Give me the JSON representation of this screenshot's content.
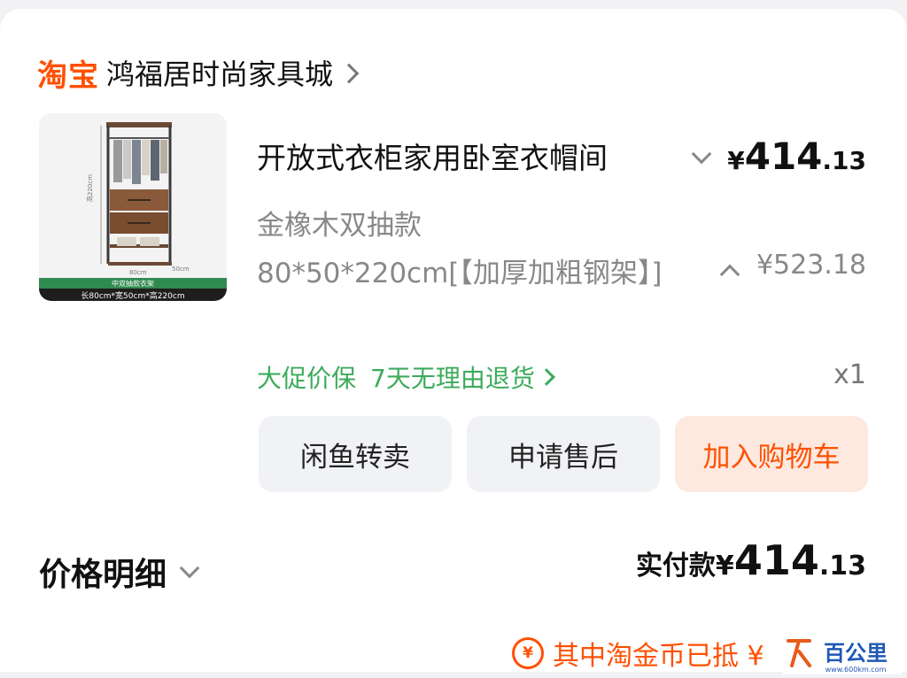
{
  "shop": {
    "logo": "淘宝",
    "name": "鸿福居时尚家具城"
  },
  "product": {
    "title": "开放式衣柜家用卧室衣帽间",
    "price_symbol": "¥",
    "price_int": "414",
    "price_dec": ".13",
    "spec": "金橡木双抽款 80*50*220cm[【加厚加粗钢架】]",
    "original_price": "¥523.18",
    "quantity": "x1",
    "services": [
      "大促价保",
      "7天无理由退货"
    ],
    "thumb_caption_top": "中双抽款衣架",
    "thumb_caption_bottom": "长80cm*宽50cm*高220cm",
    "thumb_dim_height": "高220cm",
    "thumb_dim_width": "80cm",
    "thumb_dim_depth": "50cm"
  },
  "actions": {
    "resell": "闲鱼转卖",
    "after_sales": "申请售后",
    "add_to_cart": "加入购物车"
  },
  "summary": {
    "detail_label": "价格明细",
    "paid_label": "实付款¥",
    "paid_int": "414",
    "paid_dec": ".13",
    "coin_icon": "¥",
    "coin_text": "其中淘金币已抵 ¥"
  },
  "watermark": {
    "text": "百公里",
    "url_text": "www.600km.com"
  },
  "colors": {
    "brand": "#ff5000",
    "service_green": "#3cab5b",
    "gray_text": "#888888",
    "button_bg": "#f1f2f5",
    "cart_button_bg": "#fde9df"
  }
}
